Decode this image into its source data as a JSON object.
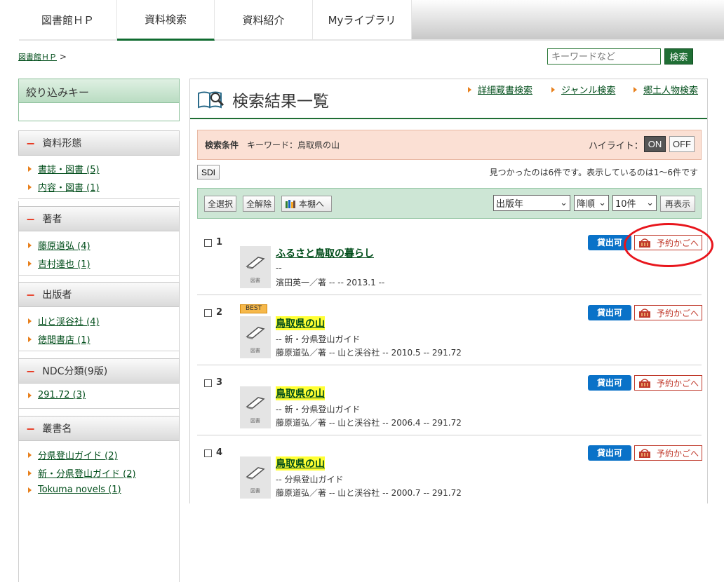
{
  "nav": {
    "tabs": [
      {
        "label": "図書館ＨＰ",
        "active": false
      },
      {
        "label": "資料検索",
        "active": true
      },
      {
        "label": "資料紹介",
        "active": false
      },
      {
        "label": "Myライブラリ",
        "active": false
      }
    ]
  },
  "breadcrumb": {
    "home": "図書館ＨＰ",
    "sep": ">"
  },
  "search": {
    "placeholder": "キーワードなど",
    "button": "検索"
  },
  "sidebar": {
    "filter_title": "絞り込みキー",
    "groups": [
      {
        "title": "資料形態",
        "items": [
          "書誌・図書 (5)",
          "内容・図書 (1)"
        ]
      },
      {
        "title": "著者",
        "items": [
          "藤原道弘 (4)",
          "吉村達也 (1)"
        ]
      },
      {
        "title": "出版者",
        "items": [
          "山と渓谷社 (4)",
          "徳間書店 (1)"
        ]
      },
      {
        "title": "NDC分類(9版)",
        "items": [
          "291.72 (3)"
        ]
      },
      {
        "title": "叢書名",
        "items": [
          "分県登山ガイド (2)",
          "新・分県登山ガイド (2)",
          "Tokuma novels (1)"
        ]
      }
    ]
  },
  "main": {
    "title": "検索結果一覧",
    "links": [
      "詳細蔵書検索",
      "ジャンル検索",
      "郷土人物検索"
    ],
    "condition": {
      "label": "検索条件",
      "value": "キーワード：鳥取県の山",
      "highlight_label": "ハイライト：",
      "on": "ON",
      "off": "OFF"
    },
    "sdi": "SDI",
    "found_text": "見つかったのは6件です。表示しているのは1～6件です",
    "toolbar": {
      "select_all": "全選択",
      "deselect_all": "全解除",
      "shelf": "本棚へ",
      "sort_field": "出版年",
      "sort_order": "降順",
      "per_page": "10件",
      "redisplay": "再表示"
    },
    "results": [
      {
        "num": "1",
        "best": "",
        "title": "ふるさと鳥取の暮らし",
        "highlight": false,
        "line1": "--",
        "line2": "濱田英一／著 -- -- 2013.1 --"
      },
      {
        "num": "2",
        "best": "BEST",
        "title": "鳥取県の山",
        "highlight": true,
        "line1": "-- 新・分県登山ガイド",
        "line2": "藤原道弘／著 -- 山と渓谷社 -- 2010.5 -- 291.72"
      },
      {
        "num": "3",
        "best": "",
        "title": "鳥取県の山",
        "highlight": true,
        "line1": "-- 新・分県登山ガイド",
        "line2": "藤原道弘／著 -- 山と渓谷社 -- 2006.4 -- 291.72"
      },
      {
        "num": "4",
        "best": "",
        "title": "鳥取県の山",
        "highlight": true,
        "line1": "-- 分県登山ガイド",
        "line2": "藤原道弘／著 -- 山と渓谷社 -- 2000.7 -- 291.72"
      }
    ],
    "availability": "貸出可",
    "cart": "予約かごへ",
    "thumb_caption": "図書"
  },
  "colors": {
    "brand_green": "#1f6e34",
    "condition_bg": "#fbe0d4",
    "toolbar_bg": "#cde6d5",
    "available_blue": "#0a72c8",
    "cart_red": "#c0392b",
    "annotation_red": "#e8151c",
    "highlight_yellow": "#ffff33"
  }
}
